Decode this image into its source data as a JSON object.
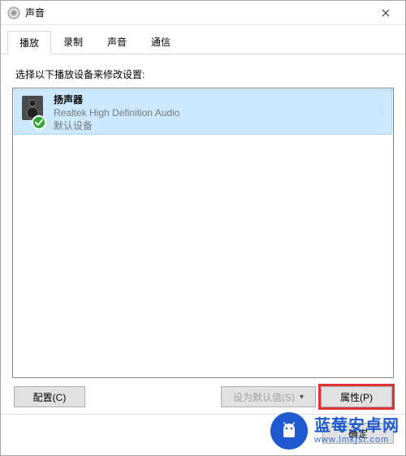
{
  "window": {
    "title": "声音"
  },
  "tabs": {
    "playback": "播放",
    "recording": "录制",
    "sounds": "声音",
    "communications": "通信"
  },
  "content": {
    "instruction": "选择以下播放设备来修改设置:"
  },
  "device": {
    "name": "扬声器",
    "driver": "Realtek High Definition Audio",
    "status": "默认设备"
  },
  "buttons": {
    "configure": "配置(C)",
    "set_default": "设为默认值(S)",
    "properties": "属性(P)",
    "ok": "确定"
  },
  "watermark": {
    "line1": "蓝莓安卓网",
    "line2": "www.lmkjst.com"
  }
}
